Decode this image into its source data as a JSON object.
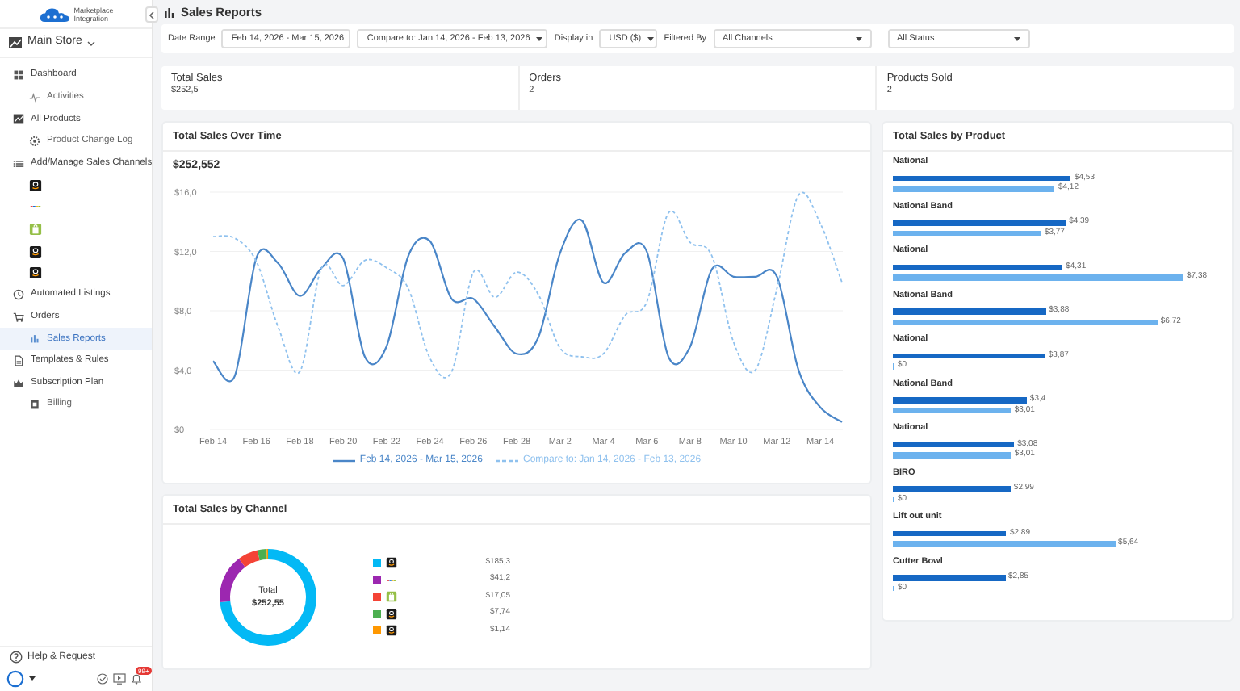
{
  "sidebar": {
    "logo": [
      "Marketplace",
      "Integration"
    ],
    "store": "Main Store",
    "items": [
      {
        "label": "Dashboard",
        "kind": "grid",
        "selected": false,
        "children": [
          {
            "label": "Activities",
            "kind": "pulse",
            "selected": false
          }
        ]
      },
      {
        "label": "All Products",
        "kind": "chart",
        "selected": false,
        "children": [
          {
            "label": "Product Change Log",
            "kind": "gear",
            "selected": false
          }
        ]
      },
      {
        "label": "Add/Manage Sales Channels",
        "kind": "list",
        "selected": false,
        "children": [
          {
            "kind": "tile",
            "selected": false
          },
          {
            "kind": "mark",
            "selected": false
          },
          {
            "kind": "bag",
            "selected": false
          },
          {
            "kind": "tile",
            "selected": false
          },
          {
            "kind": "tile",
            "selected": false
          }
        ]
      },
      {
        "label": "Automated Listings",
        "kind": "clock",
        "selected": false
      },
      {
        "label": "Orders",
        "kind": "cart",
        "selected": false,
        "children": [
          {
            "label": "Sales Reports",
            "kind": "bars",
            "selected": true
          }
        ]
      },
      {
        "label": "Templates & Rules",
        "kind": "doc",
        "selected": false
      },
      {
        "label": "Subscription Plan",
        "kind": "crown",
        "selected": false,
        "children": [
          {
            "label": "Billing",
            "kind": "bill",
            "selected": false
          }
        ]
      }
    ],
    "help": "Help & Request",
    "badge": "99+"
  },
  "page_title": "Sales Reports",
  "filters": {
    "date_range_label": "Date Range",
    "date_range": "Feb 14, 2026 - Mar 15, 2026",
    "compare": "Compare to: Jan 14, 2026 - Feb 13, 2026",
    "display_label": "Display in",
    "currency": "USD ($)",
    "filter_label": "Filtered By",
    "channels": "All Channels",
    "status": "All Status"
  },
  "summary": [
    {
      "label": "Total Sales",
      "value": "$252,5"
    },
    {
      "label": "Orders",
      "value": "2"
    },
    {
      "label": "Products Sold",
      "value": "2"
    }
  ],
  "sales_over_time": {
    "title": "Total Sales Over Time",
    "total": "$252,552",
    "chart_data": {
      "type": "line",
      "categories": [
        "Feb 14",
        null,
        "Feb 16",
        null,
        "Feb 18",
        null,
        "Feb 20",
        null,
        "Feb 22",
        null,
        "Feb 24",
        null,
        "Feb 26",
        null,
        "Feb 28",
        null,
        "Mar 2",
        null,
        "Mar 4",
        null,
        "Mar 6",
        null,
        "Mar 8",
        null,
        "Mar 10",
        null,
        "Mar 12",
        null,
        "Mar 14",
        null
      ],
      "yticks": [
        {
          "value": 0,
          "label": "$0"
        },
        {
          "value": 4,
          "label": "$4,0"
        },
        {
          "value": 8,
          "label": "$8,0"
        },
        {
          "value": 12,
          "label": "$12,0"
        },
        {
          "value": 16,
          "label": "$16,0"
        }
      ],
      "ylim": [
        0,
        16
      ],
      "grid": true,
      "series": [
        {
          "name": "Feb 14, 2026 - Mar 15, 2026",
          "color": "#4a86c8",
          "line_style": "solid",
          "values": [
            4.6,
            3.6,
            11.6,
            11.2,
            9.0,
            10.9,
            11.5,
            4.9,
            5.6,
            11.7,
            12.7,
            8.8,
            8.8,
            6.9,
            5.1,
            6.2,
            11.9,
            14.1,
            9.9,
            11.9,
            12.0,
            4.9,
            5.6,
            10.8,
            10.3,
            10.3,
            10.3,
            4.0,
            1.5,
            0.5
          ]
        },
        {
          "name": "Compare to: Jan 14, 2026 - Feb 13, 2026",
          "color": "#8fc1ee",
          "line_style": "dashed",
          "values": [
            13.0,
            12.9,
            11.3,
            6.9,
            3.9,
            10.9,
            9.7,
            11.4,
            10.9,
            9.5,
            4.8,
            3.9,
            10.6,
            8.9,
            10.6,
            9.1,
            5.5,
            4.9,
            5.1,
            7.7,
            8.6,
            14.6,
            12.6,
            11.7,
            5.9,
            4.0,
            9.5,
            15.8,
            13.9,
            9.9
          ]
        }
      ]
    }
  },
  "sales_by_channel": {
    "title": "Total Sales by Channel",
    "center_label": "Total",
    "center_value": "$252,55",
    "channels": [
      {
        "kind": "tile",
        "color": "#03b9f5",
        "value": "$185,3"
      },
      {
        "kind": "mark",
        "color": "#9c27b0",
        "value": "$41,2"
      },
      {
        "kind": "bag",
        "color": "#f44336",
        "value": "$17,05"
      },
      {
        "kind": "tile",
        "color": "#4caf50",
        "value": "$7,74"
      },
      {
        "kind": "tile",
        "color": "#ff9800",
        "value": "$1,14"
      }
    ],
    "chart_data": {
      "type": "donut",
      "values": [
        73.41,
        16.32,
        6.75,
        3.07,
        0.45
      ]
    }
  },
  "sales_by_product": {
    "title": "Total Sales by Product",
    "chart_data": {
      "type": "bar",
      "orientation": "horizontal",
      "categories": [
        "National",
        "National Band",
        "National",
        "National Band",
        "National",
        "National Band",
        "National",
        "BIRO",
        "Lift out unit",
        "Cutter Bowl"
      ],
      "series": [
        {
          "color": "#1668c4",
          "values": [
            4.53,
            4.39,
            4.31,
            3.88,
            3.87,
            3.4,
            3.08,
            2.99,
            2.89,
            2.85
          ],
          "value_labels": [
            "$4,53",
            "$4,39",
            "$4,31",
            "$3,88",
            "$3,87",
            "$3,4",
            "$3,08",
            "$2,99",
            "$2,89",
            "$2,85"
          ]
        },
        {
          "color": "#6cb2ee",
          "values": [
            4.12,
            3.77,
            7.38,
            6.72,
            0,
            3.01,
            3.01,
            0,
            5.64,
            0
          ],
          "value_labels": [
            "$4,12",
            "$3,77",
            "$7,38",
            "$6,72",
            "$0",
            "$3,01",
            "$3,01",
            "$0",
            "$5,64",
            "$0"
          ]
        }
      ]
    }
  }
}
